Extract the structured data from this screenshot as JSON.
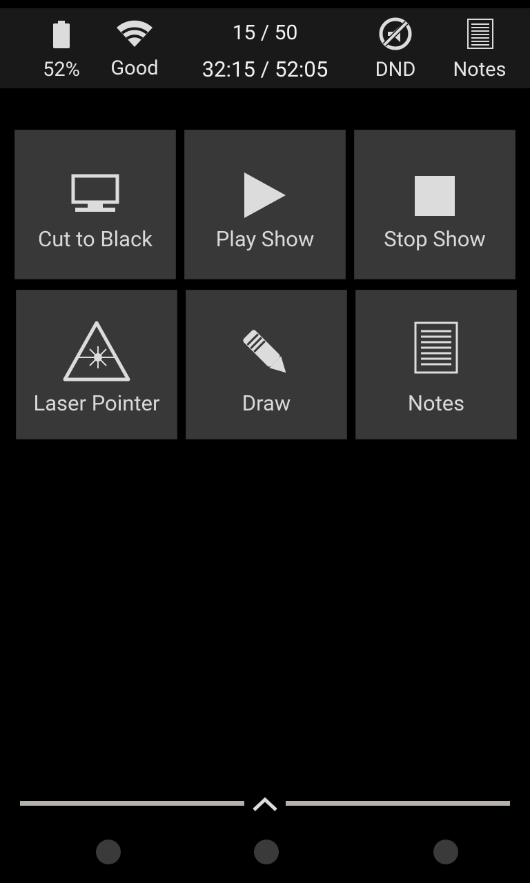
{
  "status": {
    "battery": {
      "label": "52%",
      "icon": "battery-icon"
    },
    "signal": {
      "label": "Good",
      "icon": "wifi-icon"
    },
    "slide_counter": "15 / 50",
    "timer": "32:15 / 52:05",
    "dnd": {
      "label": "DND",
      "icon": "dnd-icon"
    },
    "notes": {
      "label": "Notes",
      "icon": "notes-icon"
    }
  },
  "actions": [
    {
      "label": "Cut to Black",
      "icon": "monitor-icon"
    },
    {
      "label": "Play Show",
      "icon": "play-icon"
    },
    {
      "label": "Stop Show",
      "icon": "stop-icon"
    },
    {
      "label": "Laser Pointer",
      "icon": "laser-warning-icon"
    },
    {
      "label": "Draw",
      "icon": "pencil-icon"
    },
    {
      "label": "Notes",
      "icon": "notes-icon"
    }
  ],
  "colors": {
    "background": "#000000",
    "status_bar": "#191919",
    "tile": "#383838",
    "icon": "#dcdcdc",
    "handle": "#b4b2a9"
  }
}
